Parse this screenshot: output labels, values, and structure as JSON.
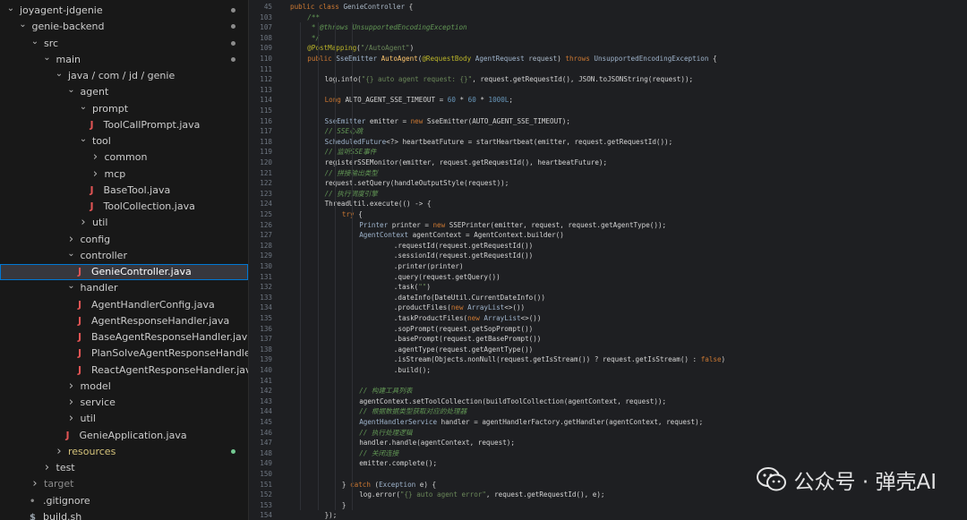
{
  "explorer": {
    "rows": [
      {
        "label": "joyagent-jdgenie",
        "kind": "folder",
        "expanded": true,
        "depth": 0,
        "dot": "gray"
      },
      {
        "label": "genie-backend",
        "kind": "folder",
        "expanded": true,
        "depth": 1,
        "dot": "gray"
      },
      {
        "label": "src",
        "kind": "folder",
        "expanded": true,
        "depth": 2,
        "dot": "gray"
      },
      {
        "label": "main",
        "kind": "folder",
        "expanded": true,
        "depth": 3,
        "dot": "gray"
      },
      {
        "label": "java / com / jd / genie",
        "kind": "folder",
        "expanded": true,
        "depth": 4
      },
      {
        "label": "agent",
        "kind": "folder",
        "expanded": true,
        "depth": 5
      },
      {
        "label": "prompt",
        "kind": "folder",
        "expanded": true,
        "depth": 6
      },
      {
        "label": "ToolCallPrompt.java",
        "kind": "java",
        "depth": 7
      },
      {
        "label": "tool",
        "kind": "folder",
        "expanded": true,
        "depth": 6
      },
      {
        "label": "common",
        "kind": "folder",
        "expanded": false,
        "depth": 7
      },
      {
        "label": "mcp",
        "kind": "folder",
        "expanded": false,
        "depth": 7
      },
      {
        "label": "BaseTool.java",
        "kind": "java",
        "depth": 7
      },
      {
        "label": "ToolCollection.java",
        "kind": "java",
        "depth": 7
      },
      {
        "label": "util",
        "kind": "folder",
        "expanded": false,
        "depth": 6
      },
      {
        "label": "config",
        "kind": "folder",
        "expanded": false,
        "depth": 5
      },
      {
        "label": "controller",
        "kind": "folder",
        "expanded": true,
        "depth": 5
      },
      {
        "label": "GenieController.java",
        "kind": "java",
        "depth": 6,
        "selected": true
      },
      {
        "label": "handler",
        "kind": "folder",
        "expanded": true,
        "depth": 5
      },
      {
        "label": "AgentHandlerConfig.java",
        "kind": "java",
        "depth": 6
      },
      {
        "label": "AgentResponseHandler.java",
        "kind": "java",
        "depth": 6
      },
      {
        "label": "BaseAgentResponseHandler.java",
        "kind": "java",
        "depth": 6
      },
      {
        "label": "PlanSolveAgentResponseHandler.java",
        "kind": "java",
        "depth": 6
      },
      {
        "label": "ReactAgentResponseHandler.java",
        "kind": "java",
        "depth": 6
      },
      {
        "label": "model",
        "kind": "folder",
        "expanded": false,
        "depth": 5
      },
      {
        "label": "service",
        "kind": "folder",
        "expanded": false,
        "depth": 5
      },
      {
        "label": "util",
        "kind": "folder",
        "expanded": false,
        "depth": 5
      },
      {
        "label": "GenieApplication.java",
        "kind": "java",
        "depth": 5
      },
      {
        "label": "resources",
        "kind": "folder",
        "expanded": false,
        "depth": 4,
        "color": "#d4c27a",
        "dot": "green"
      },
      {
        "label": "test",
        "kind": "folder",
        "expanded": false,
        "depth": 3
      },
      {
        "label": "target",
        "kind": "folder",
        "expanded": false,
        "depth": 2,
        "color": "#8b8b8b"
      },
      {
        "label": ".gitignore",
        "kind": "file",
        "depth": 2
      },
      {
        "label": "build.sh",
        "kind": "shell",
        "depth": 2
      }
    ]
  },
  "editor": {
    "lines": [
      {
        "n": "45",
        "indent": 0,
        "tokens": [
          [
            "kw",
            "public class "
          ],
          [
            "ty",
            "GenieController "
          ],
          [
            "",
            "{"
          ]
        ]
      },
      {
        "n": "103",
        "indent": 1,
        "tokens": [
          [
            "doc",
            "/**"
          ]
        ]
      },
      {
        "n": "107",
        "indent": 1,
        "tokens": [
          [
            "doc",
            " * "
          ],
          [
            "doc",
            "@throws "
          ],
          [
            "doc",
            "UnsupportedEncodingException"
          ]
        ]
      },
      {
        "n": "108",
        "indent": 1,
        "tokens": [
          [
            "doc",
            " */"
          ]
        ]
      },
      {
        "n": "109",
        "indent": 1,
        "tokens": [
          [
            "an",
            "@PostMapping"
          ],
          [
            "",
            "("
          ],
          [
            "str",
            "\"/AutoAgent\""
          ],
          [
            "",
            ")"
          ]
        ]
      },
      {
        "n": "110",
        "indent": 1,
        "tokens": [
          [
            "kw",
            "public "
          ],
          [
            "typ",
            "SseEmitter "
          ],
          [
            "fn",
            "AutoAgent"
          ],
          [
            "",
            "("
          ],
          [
            "an",
            "@RequestBody "
          ],
          [
            "typ",
            "AgentRequest "
          ],
          [
            "ty",
            "request"
          ],
          [
            "",
            ") "
          ],
          [
            "kw",
            "throws "
          ],
          [
            "typ",
            "UnsupportedEncodingException "
          ],
          [
            "",
            "{"
          ]
        ]
      },
      {
        "n": "111",
        "indent": 0,
        "tokens": []
      },
      {
        "n": "112",
        "indent": 2,
        "tokens": [
          [
            "",
            "log.info("
          ],
          [
            "str",
            "\"{} auto agent request: {}\""
          ],
          [
            "",
            ", request.getRequestId(), JSON.toJSONString(request));"
          ]
        ]
      },
      {
        "n": "113",
        "indent": 0,
        "tokens": []
      },
      {
        "n": "114",
        "indent": 2,
        "tokens": [
          [
            "kw",
            "Long "
          ],
          [
            "",
            "AUTO_AGENT_SSE_TIMEOUT = "
          ],
          [
            "num",
            "60"
          ],
          [
            "",
            " * "
          ],
          [
            "num",
            "60"
          ],
          [
            "",
            " * "
          ],
          [
            "num",
            "1000L"
          ],
          [
            "",
            ";"
          ]
        ]
      },
      {
        "n": "115",
        "indent": 0,
        "tokens": []
      },
      {
        "n": "116",
        "indent": 2,
        "tokens": [
          [
            "typ",
            "SseEmitter "
          ],
          [
            "",
            "emitter = "
          ],
          [
            "kw",
            "new "
          ],
          [
            "",
            "SseEmitter(AUTO_AGENT_SSE_TIMEOUT);"
          ]
        ]
      },
      {
        "n": "117",
        "indent": 2,
        "tokens": [
          [
            "cm",
            "// SSE心跳"
          ]
        ]
      },
      {
        "n": "118",
        "indent": 2,
        "tokens": [
          [
            "typ",
            "ScheduledFuture"
          ],
          [
            "",
            "<?> heartbeatFuture = startHeartbeat(emitter, request.getRequestId());"
          ]
        ]
      },
      {
        "n": "119",
        "indent": 2,
        "tokens": [
          [
            "cm",
            "// 监听SSE事件"
          ]
        ]
      },
      {
        "n": "120",
        "indent": 2,
        "tokens": [
          [
            "",
            "registerSSEMonitor(emitter, request.getRequestId(), heartbeatFuture);"
          ]
        ]
      },
      {
        "n": "121",
        "indent": 2,
        "tokens": [
          [
            "cm",
            "// 拼接输出类型"
          ]
        ]
      },
      {
        "n": "122",
        "indent": 2,
        "tokens": [
          [
            "",
            "request.setQuery(handleOutputStyle(request));"
          ]
        ]
      },
      {
        "n": "123",
        "indent": 2,
        "tokens": [
          [
            "cm",
            "// 执行调度引擎"
          ]
        ]
      },
      {
        "n": "124",
        "indent": 2,
        "tokens": [
          [
            "",
            "ThreadUtil.execute(() -> {"
          ]
        ]
      },
      {
        "n": "125",
        "indent": 3,
        "tokens": [
          [
            "kw",
            "try "
          ],
          [
            "",
            "{"
          ]
        ]
      },
      {
        "n": "126",
        "indent": 4,
        "tokens": [
          [
            "typ",
            "Printer "
          ],
          [
            "",
            "printer = "
          ],
          [
            "kw",
            "new "
          ],
          [
            "",
            "SSEPrinter(emitter, request, request.getAgentType());"
          ]
        ]
      },
      {
        "n": "127",
        "indent": 4,
        "tokens": [
          [
            "typ",
            "AgentContext "
          ],
          [
            "",
            "agentContext = AgentContext.builder()"
          ]
        ]
      },
      {
        "n": "128",
        "indent": 6,
        "tokens": [
          [
            "",
            ".requestId(request.getRequestId())"
          ]
        ]
      },
      {
        "n": "129",
        "indent": 6,
        "tokens": [
          [
            "",
            ".sessionId(request.getRequestId())"
          ]
        ]
      },
      {
        "n": "130",
        "indent": 6,
        "tokens": [
          [
            "",
            ".printer(printer)"
          ]
        ]
      },
      {
        "n": "131",
        "indent": 6,
        "tokens": [
          [
            "",
            ".query(request.getQuery())"
          ]
        ]
      },
      {
        "n": "132",
        "indent": 6,
        "tokens": [
          [
            "",
            ".task("
          ],
          [
            "str",
            "\"\""
          ],
          [
            "",
            ")"
          ]
        ]
      },
      {
        "n": "133",
        "indent": 6,
        "tokens": [
          [
            "",
            ".dateInfo(DateUtil.CurrentDateInfo())"
          ]
        ]
      },
      {
        "n": "134",
        "indent": 6,
        "tokens": [
          [
            "",
            ".productFiles("
          ],
          [
            "kw",
            "new "
          ],
          [
            "typ",
            "ArrayList"
          ],
          [
            "",
            "<>())"
          ]
        ]
      },
      {
        "n": "135",
        "indent": 6,
        "tokens": [
          [
            "",
            ".taskProductFiles("
          ],
          [
            "kw",
            "new "
          ],
          [
            "typ",
            "ArrayList"
          ],
          [
            "",
            "<>())"
          ]
        ]
      },
      {
        "n": "136",
        "indent": 6,
        "tokens": [
          [
            "",
            ".sopPrompt(request.getSopPrompt())"
          ]
        ]
      },
      {
        "n": "137",
        "indent": 6,
        "tokens": [
          [
            "",
            ".basePrompt(request.getBasePrompt())"
          ]
        ]
      },
      {
        "n": "138",
        "indent": 6,
        "tokens": [
          [
            "",
            ".agentType(request.getAgentType())"
          ]
        ]
      },
      {
        "n": "139",
        "indent": 6,
        "tokens": [
          [
            "",
            ".isStream(Objects.nonNull(request.getIsStream()) ? request.getIsStream() : "
          ],
          [
            "kw",
            "false"
          ],
          [
            "",
            ")"
          ]
        ]
      },
      {
        "n": "140",
        "indent": 6,
        "tokens": [
          [
            "",
            ".build();"
          ]
        ]
      },
      {
        "n": "141",
        "indent": 0,
        "tokens": []
      },
      {
        "n": "142",
        "indent": 4,
        "tokens": [
          [
            "cm",
            "// 构建工具列表"
          ]
        ]
      },
      {
        "n": "143",
        "indent": 4,
        "tokens": [
          [
            "",
            "agentContext.setToolCollection(buildToolCollection(agentContext, request));"
          ]
        ]
      },
      {
        "n": "144",
        "indent": 4,
        "tokens": [
          [
            "cm",
            "// 根据数据类型获取对应的处理器"
          ]
        ]
      },
      {
        "n": "145",
        "indent": 4,
        "tokens": [
          [
            "typ",
            "AgentHandlerService "
          ],
          [
            "",
            "handler = agentHandlerFactory.getHandler(agentContext, request);"
          ]
        ]
      },
      {
        "n": "146",
        "indent": 4,
        "tokens": [
          [
            "cm",
            "// 执行处理逻辑"
          ]
        ]
      },
      {
        "n": "147",
        "indent": 4,
        "tokens": [
          [
            "",
            "handler.handle(agentContext, request);"
          ]
        ]
      },
      {
        "n": "148",
        "indent": 4,
        "tokens": [
          [
            "cm",
            "// 关闭连接"
          ]
        ]
      },
      {
        "n": "149",
        "indent": 4,
        "tokens": [
          [
            "",
            "emitter.complete();"
          ]
        ]
      },
      {
        "n": "150",
        "indent": 0,
        "tokens": []
      },
      {
        "n": "151",
        "indent": 3,
        "tokens": [
          [
            "",
            "} "
          ],
          [
            "kw",
            "catch "
          ],
          [
            "",
            "("
          ],
          [
            "typ",
            "Exception "
          ],
          [
            "",
            "e) {"
          ]
        ]
      },
      {
        "n": "152",
        "indent": 4,
        "tokens": [
          [
            "",
            "log.error("
          ],
          [
            "str",
            "\"{} auto agent error\""
          ],
          [
            "",
            ", request.getRequestId(), e);"
          ]
        ]
      },
      {
        "n": "153",
        "indent": 3,
        "tokens": [
          [
            "",
            "}"
          ]
        ]
      },
      {
        "n": "154",
        "indent": 2,
        "tokens": [
          [
            "",
            "});"
          ]
        ]
      }
    ]
  },
  "watermark": {
    "text": "公众号 · 弹壳AI",
    "icon": "wechat-icon"
  },
  "colors": {
    "explorer_bg": "#181818",
    "editor_bg": "#1e1f22",
    "selected_row": "#37373d",
    "selection_border": "#0078d4",
    "java_icon": "#e05454",
    "keyword": "#cc7832",
    "string": "#6a8759",
    "comment": "#629755",
    "annotation": "#bbb529"
  }
}
